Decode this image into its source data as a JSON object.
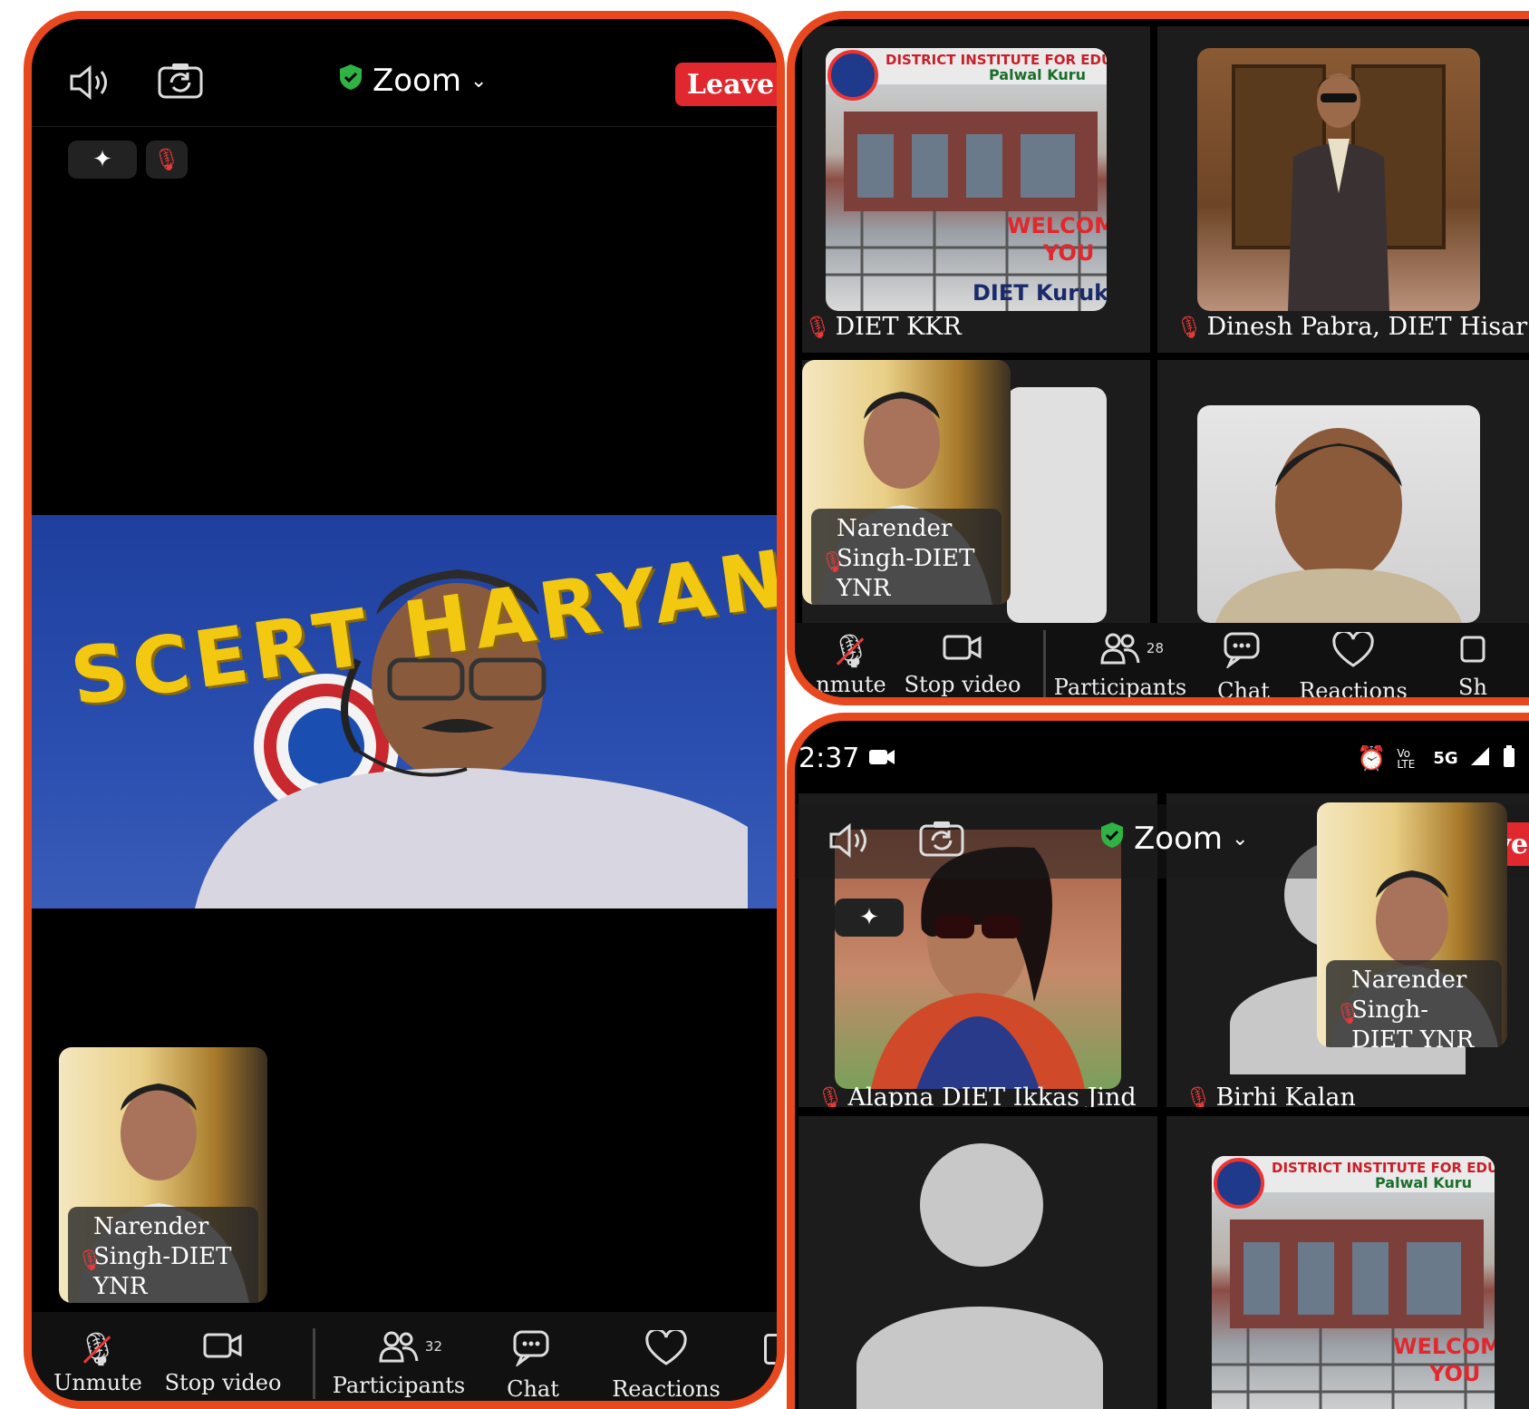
{
  "left_screen": {
    "app_title": "Zoom",
    "leave_label": "Leave",
    "active_speaker_banner": "SCERT HARYANA",
    "self_view_name": "Narender Singh-DIET YNR",
    "toolbar": {
      "unmute": "Unmute",
      "stop_video": "Stop video",
      "participants": "Participants",
      "participants_count": "32",
      "chat": "Chat",
      "reactions": "Reactions"
    }
  },
  "right_top_screen": {
    "tiles": [
      {
        "name": "DIET KKR",
        "banner_line1": "DISTRICT INSTITUTE FOR EDU",
        "banner_line2": "Palwal Kuru",
        "welcome": "WELCOM",
        "you": "YOU",
        "sign": "DIET Kuruk"
      },
      {
        "name": "Dinesh Pabra, DIET Hisar"
      },
      {
        "name": "Narender Singh-DIET YNR"
      },
      {
        "name": ""
      }
    ],
    "toolbar": {
      "unmute": "nmute",
      "stop_video": "Stop video",
      "participants": "Participants",
      "participants_count": "28",
      "chat": "Chat",
      "reactions": "Reactions",
      "share": "Sh"
    }
  },
  "right_bottom_screen": {
    "status_time": "2:37",
    "status_network": "5G",
    "status_volte": "Vo LTE",
    "app_title": "Zoom",
    "leave_label": "Leave",
    "tiles": [
      {
        "name": "Alapna DIET Ikkas Jind"
      },
      {
        "name": "Birhi Kalan"
      },
      {
        "name": ""
      },
      {
        "name": "",
        "banner_line1": "DISTRICT INSTITUTE FOR EDU",
        "banner_line2": "Palwal Kuru",
        "welcome": "WELCOM",
        "you": "YOU"
      }
    ],
    "self_view_name": "Narender Singh-DIET YNR"
  },
  "colors": {
    "frame_border": "#e8481e",
    "leave_button": "#e0282e",
    "mic_muted": "#e83a3a",
    "shield_green": "#2fb344"
  }
}
